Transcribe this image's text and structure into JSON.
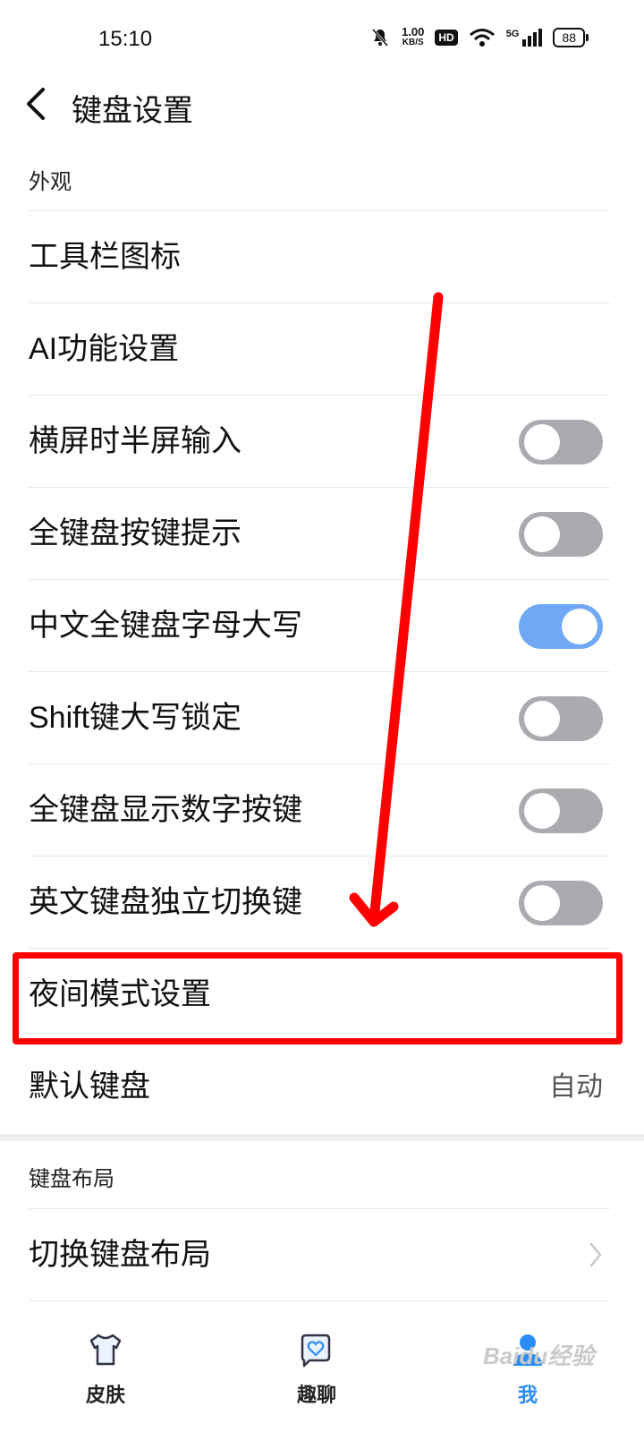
{
  "status_bar": {
    "time": "15:10",
    "speed_value": "1.00",
    "speed_unit": "KB/S",
    "hd": "HD",
    "network": "5G",
    "battery": "88"
  },
  "header": {
    "title": "键盘设置"
  },
  "sections": [
    {
      "label": "外观",
      "items": [
        {
          "label": "工具栏图标"
        },
        {
          "label": "AI功能设置"
        },
        {
          "label": "横屏时半屏输入",
          "toggle": false
        },
        {
          "label": "全键盘按键提示",
          "toggle": false
        },
        {
          "label": "中文全键盘字母大写",
          "toggle": true
        },
        {
          "label": "Shift键大写锁定",
          "toggle": false
        },
        {
          "label": "全键盘显示数字按键",
          "toggle": false
        },
        {
          "label": "英文键盘独立切换键",
          "toggle": false
        },
        {
          "label": "夜间模式设置",
          "highlighted": true
        },
        {
          "label": "默认键盘",
          "value": "自动"
        }
      ]
    },
    {
      "label": "键盘布局",
      "items": [
        {
          "label": "切换键盘布局"
        }
      ]
    }
  ],
  "bottom_nav": {
    "items": [
      {
        "label": "皮肤",
        "icon": "shirt-icon"
      },
      {
        "label": "趣聊",
        "icon": "chat-heart-icon"
      },
      {
        "label": "我",
        "icon": "profile-icon"
      }
    ]
  },
  "watermark": "Baidu经验",
  "colors": {
    "toggle_on": "#6fa8f5",
    "toggle_off": "#a9abb0",
    "annotation": "#ff0000"
  }
}
